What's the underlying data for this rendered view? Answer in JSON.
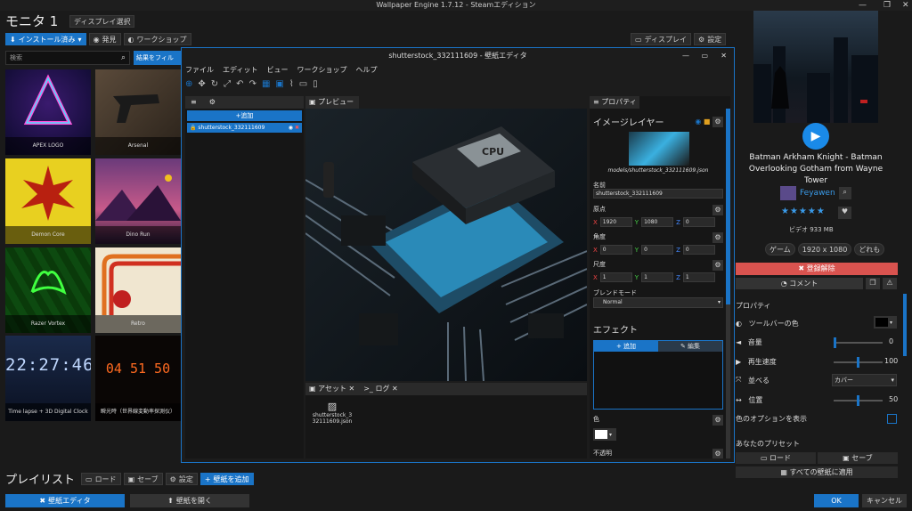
{
  "window": {
    "title": "Wallpaper Engine 1.7.12 - Steamエディション",
    "min": "—",
    "max": "❐",
    "close": "✕"
  },
  "header": {
    "monitor": "モニタ 1",
    "display_select": "ディスプレイ選択"
  },
  "tabs": {
    "installed": "インストール済み",
    "discover": "発見",
    "workshop": "ワークショップ"
  },
  "top_right": {
    "display": "ディスプレイ",
    "settings": "設定"
  },
  "search": {
    "placeholder": "検索",
    "filter": "結果をフィル"
  },
  "tiles": [
    "APEX LOGO",
    "Arsenal",
    "Demon Core",
    "Dino Run",
    "Razer Vortex",
    "Retro",
    "Time lapse + 3D Digital Clock",
    "瞬光時（世界線変動率探測仪）"
  ],
  "clock_text": "22:27:46",
  "nixie_text": "04 51 50",
  "playlist": {
    "title": "プレイリスト",
    "load": "ロード",
    "save": "セーブ",
    "settings": "設定",
    "add": "壁紙を追加"
  },
  "bottom": {
    "editor": "壁紙エディタ",
    "open": "壁紙を開く",
    "ok": "OK",
    "cancel": "キャンセル"
  },
  "editor": {
    "title": "shutterstock_332111609 - 壁紙エディタ",
    "menu": [
      "ファイル",
      "エディット",
      "ビュー",
      "ワークショップ",
      "ヘルプ"
    ],
    "add": "追加",
    "layer": "shutterstock_332111609",
    "preview_tab": "プレビュー",
    "assets_tab": "アセット",
    "log_tab": "ログ",
    "asset_file": "shutterstock_332111609.json",
    "chip_cpu": "CPU",
    "props_tab": "プロパティ",
    "image_layer": "イメージレイヤー",
    "model_path": "models/shutterstock_332111609.json",
    "name_label": "名前",
    "name_value": "shutterstock_332111609",
    "origin_label": "原点",
    "origin": {
      "x": "1920",
      "y": "1080",
      "z": "0"
    },
    "angle_label": "角度",
    "angle": {
      "x": "0",
      "y": "0",
      "z": "0"
    },
    "scale_label": "尺度",
    "scale": {
      "x": "1",
      "y": "1",
      "z": "1"
    },
    "blend_label": "ブレンドモード",
    "blend_value": "Normal",
    "effects": "エフェクト",
    "effects_add": "追加",
    "effects_edit": "編集",
    "color_label": "色",
    "opacity_label": "不透明"
  },
  "details": {
    "title": "Batman Arkham Knight - Batman Overlooking Gotham from Wayne Tower",
    "author": "Feyawen",
    "rating": 5,
    "meta": "ビデオ 933 MB",
    "tags": [
      "ゲーム",
      "1920 x 1080",
      "どれも"
    ],
    "unsubscribe": "登録解除",
    "comment": "コメント",
    "properties": "プロパティ",
    "toolbar_color": "ツールバーの色",
    "volume": "音量",
    "volume_value": "0",
    "speed": "再生速度",
    "speed_value": "100",
    "align": "並べる",
    "align_value": "カバー",
    "position": "位置",
    "position_value": "50",
    "show_color_options": "色のオプションを表示",
    "presets": "あなたのプリセット",
    "preset_load": "ロード",
    "preset_save": "セーブ",
    "apply_all": "すべての壁紙に適用"
  },
  "colors": {
    "accent": "#1a74c7",
    "danger": "#d9534f"
  }
}
